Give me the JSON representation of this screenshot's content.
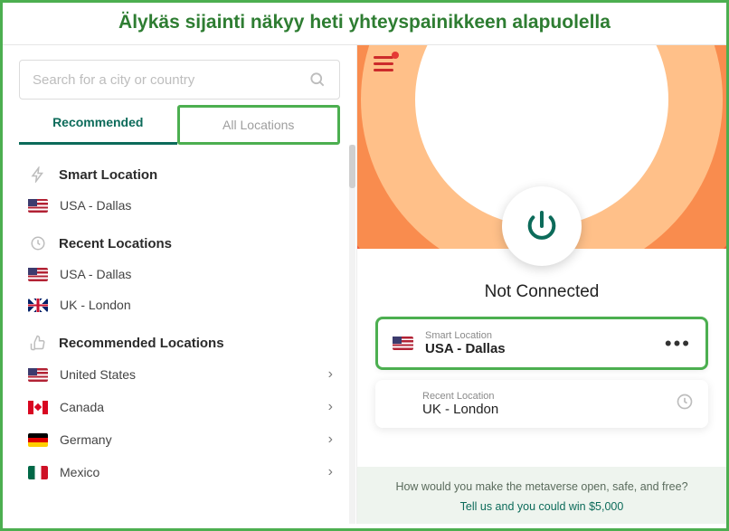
{
  "caption": "Älykäs sijainti näkyy heti yhteyspainikkeen alapuolella",
  "search": {
    "placeholder": "Search for a city or country"
  },
  "tabs": {
    "recommended": "Recommended",
    "all": "All Locations"
  },
  "sections": {
    "smart": {
      "title": "Smart Location",
      "item": "USA - Dallas"
    },
    "recent": {
      "title": "Recent Locations",
      "items": [
        "USA - Dallas",
        "UK - London"
      ]
    },
    "recommended": {
      "title": "Recommended Locations",
      "items": [
        "United States",
        "Canada",
        "Germany",
        "Mexico"
      ]
    }
  },
  "connection": {
    "status": "Not Connected",
    "smart": {
      "label": "Smart Location",
      "value": "USA - Dallas"
    },
    "recent": {
      "label": "Recent Location",
      "value": "UK - London"
    }
  },
  "promo": {
    "line1": "How would you make the metaverse open, safe, and free?",
    "line2": "Tell us and you could win $5,000"
  }
}
